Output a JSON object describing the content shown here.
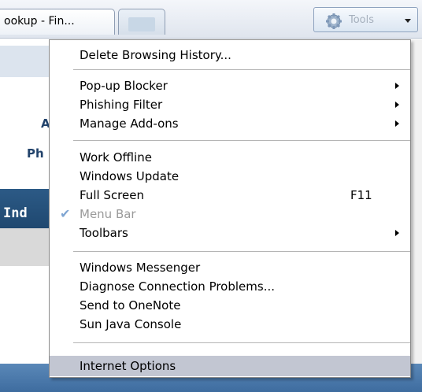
{
  "toolbar": {
    "tab_title": "ookup - Fin...",
    "tools_label": "Tools"
  },
  "page": {
    "fragment_1": "A",
    "fragment_2": "Ph",
    "fragment_3": "Ind"
  },
  "menu": {
    "items": [
      {
        "label": "Delete Browsing History...",
        "shortcut": "",
        "submenu": false,
        "checked": false,
        "disabled": false
      },
      {
        "label": "Pop-up Blocker",
        "shortcut": "",
        "submenu": true,
        "checked": false,
        "disabled": false
      },
      {
        "label": "Phishing Filter",
        "shortcut": "",
        "submenu": true,
        "checked": false,
        "disabled": false
      },
      {
        "label": "Manage Add-ons",
        "shortcut": "",
        "submenu": true,
        "checked": false,
        "disabled": false
      },
      {
        "label": "Work Offline",
        "shortcut": "",
        "submenu": false,
        "checked": false,
        "disabled": false
      },
      {
        "label": "Windows Update",
        "shortcut": "",
        "submenu": false,
        "checked": false,
        "disabled": false
      },
      {
        "label": "Full Screen",
        "shortcut": "F11",
        "submenu": false,
        "checked": false,
        "disabled": false
      },
      {
        "label": "Menu Bar",
        "shortcut": "",
        "submenu": false,
        "checked": true,
        "disabled": true
      },
      {
        "label": "Toolbars",
        "shortcut": "",
        "submenu": true,
        "checked": false,
        "disabled": false
      },
      {
        "label": "Windows Messenger",
        "shortcut": "",
        "submenu": false,
        "checked": false,
        "disabled": false
      },
      {
        "label": "Diagnose Connection Problems...",
        "shortcut": "",
        "submenu": false,
        "checked": false,
        "disabled": false
      },
      {
        "label": "Send to OneNote",
        "shortcut": "",
        "submenu": false,
        "checked": false,
        "disabled": false
      },
      {
        "label": "Sun Java Console",
        "shortcut": "",
        "submenu": false,
        "checked": false,
        "disabled": false
      },
      {
        "label": "Internet Options",
        "shortcut": "",
        "submenu": false,
        "checked": false,
        "disabled": false,
        "highlighted": true
      }
    ]
  },
  "icons": {
    "home": "home-icon",
    "tools": "gear-icon",
    "check": "checkmark-icon"
  },
  "colors": {
    "menu_highlight": "#c2c6d2",
    "page_header_blue": "#2c5a86",
    "tools_label_gray": "#a6b0bd",
    "check_blue": "#7fa5d2"
  }
}
